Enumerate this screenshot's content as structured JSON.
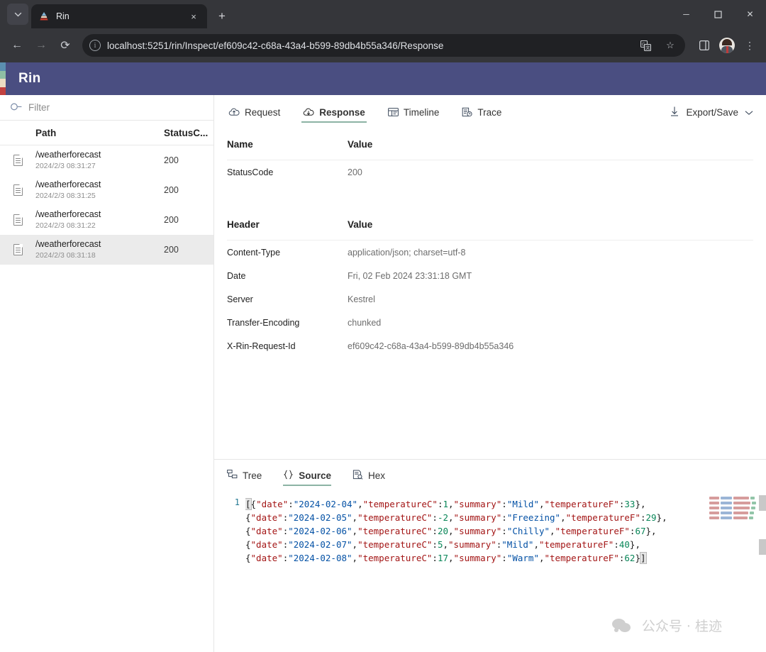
{
  "browser": {
    "tab": {
      "title": "Rin",
      "favicon": "pyramid-logo"
    },
    "tab_search_icon": "chevron-down-icon",
    "new_tab_label": "+",
    "close_label": "×",
    "window": {
      "minimize": "─",
      "maximize": "☐",
      "close": "✕"
    },
    "nav": {
      "back": "←",
      "forward": "→",
      "reload": "⟳"
    },
    "omnibox": {
      "info_glyph": "i",
      "url": "localhost:5251/rin/Inspect/ef609c42-c68a-43a4-b599-89db4b55a346/Response",
      "translate_icon": "translate-icon",
      "bookmark_icon": "☆"
    },
    "toolbar_right": {
      "side_panel_icon": "▢",
      "profile_icon": "avatar",
      "menu_icon": "⋮"
    }
  },
  "app": {
    "title": "Rin",
    "header_bg": "#4a4e81",
    "logo_colors": [
      "#5b8fb0",
      "#8fbfa4",
      "#ecdcc2",
      "#c2413f"
    ]
  },
  "sidebar": {
    "filter": {
      "placeholder": "Filter",
      "value": "",
      "icon": "search-icon"
    },
    "columns": {
      "path": "Path",
      "status": "StatusC..."
    },
    "rows": [
      {
        "icon": "document-icon",
        "path": "/weatherforecast",
        "time": "2024/2/3 08:31:27",
        "status": "200",
        "selected": false
      },
      {
        "icon": "document-icon",
        "path": "/weatherforecast",
        "time": "2024/2/3 08:31:25",
        "status": "200",
        "selected": false
      },
      {
        "icon": "document-icon",
        "path": "/weatherforecast",
        "time": "2024/2/3 08:31:22",
        "status": "200",
        "selected": false
      },
      {
        "icon": "document-icon",
        "path": "/weatherforecast",
        "time": "2024/2/3 08:31:18",
        "status": "200",
        "selected": true
      }
    ]
  },
  "main": {
    "tabs": [
      {
        "label": "Request",
        "icon": "cloud-upload-icon",
        "active": false
      },
      {
        "label": "Response",
        "icon": "cloud-download-icon",
        "active": true
      },
      {
        "label": "Timeline",
        "icon": "timeline-icon",
        "active": false
      },
      {
        "label": "Trace",
        "icon": "trace-icon",
        "active": false
      }
    ],
    "export": {
      "label": "Export/Save",
      "icon": "download-icon",
      "chevron": "chevron-down-icon"
    },
    "status_table": {
      "head": {
        "name": "Name",
        "value": "Value"
      },
      "rows": [
        {
          "name": "StatusCode",
          "value": "200"
        }
      ]
    },
    "header_table": {
      "head": {
        "name": "Header",
        "value": "Value"
      },
      "rows": [
        {
          "name": "Content-Type",
          "value": "application/json; charset=utf-8"
        },
        {
          "name": "Date",
          "value": "Fri, 02 Feb 2024 23:31:18 GMT"
        },
        {
          "name": "Server",
          "value": "Kestrel"
        },
        {
          "name": "Transfer-Encoding",
          "value": "chunked"
        },
        {
          "name": "X-Rin-Request-Id",
          "value": "ef609c42-c68a-43a4-b599-89db4b55a346"
        }
      ]
    }
  },
  "editor": {
    "tabs": [
      {
        "label": "Tree",
        "icon": "tree-icon",
        "active": false
      },
      {
        "label": "Source",
        "icon": "braces-icon",
        "active": true
      },
      {
        "label": "Hex",
        "icon": "hex-icon",
        "active": false
      }
    ],
    "line_number": "1",
    "colors": {
      "key": "#a31515",
      "string": "#0451a5",
      "number": "#098658",
      "punct": "#1b1b1b",
      "gutter": "#237893"
    },
    "json_records": [
      {
        "date": "2024-02-04",
        "temperatureC": "1",
        "summary": "Mild",
        "temperatureF": "33"
      },
      {
        "date": "2024-02-05",
        "temperatureC": "-2",
        "summary": "Freezing",
        "temperatureF": "29"
      },
      {
        "date": "2024-02-06",
        "temperatureC": "20",
        "summary": "Chilly",
        "temperatureF": "67"
      },
      {
        "date": "2024-02-07",
        "temperatureC": "5",
        "summary": "Mild",
        "temperatureF": "40"
      },
      {
        "date": "2024-02-08",
        "temperatureC": "17",
        "summary": "Warm",
        "temperatureF": "62"
      }
    ],
    "keys": {
      "date": "date",
      "temperatureC": "temperatureC",
      "summary": "summary",
      "temperatureF": "temperatureF"
    }
  },
  "watermark": {
    "text": "公众号 · 桂迹",
    "icon": "wechat-icon"
  }
}
